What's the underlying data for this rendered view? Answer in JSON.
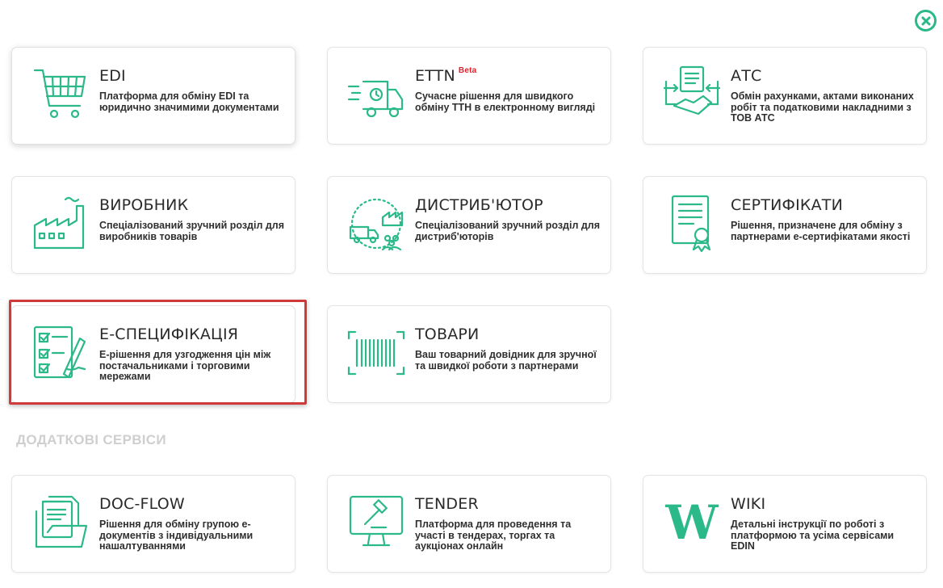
{
  "colors": {
    "accent": "#2bb98a",
    "beta": "#e0202a",
    "highlight": "#d13a3a",
    "section": "#cfcfcf"
  },
  "close_icon": "close-circle-icon",
  "services": [
    {
      "id": "edi",
      "icon": "shopping-cart-icon",
      "title": "EDI",
      "badge": "",
      "desc": "Платформа для обміну EDI та юридично значимими документами"
    },
    {
      "id": "ettn",
      "icon": "delivery-truck-icon",
      "title": "ETTN",
      "badge": "Beta",
      "desc": "Сучасне рішення для швидкого обміну ТТН в електронному вигляді"
    },
    {
      "id": "atc",
      "icon": "document-handshake-icon",
      "title": "АТС",
      "badge": "",
      "desc": "Обмін рахунками, актами виконаних робіт та податковими накладними з ТОВ АТС"
    },
    {
      "id": "vyrobnyk",
      "icon": "factory-icon",
      "title": "ВИРОБНИК",
      "badge": "",
      "desc": "Спеціалізований зручний розділ для виробників товарів"
    },
    {
      "id": "distributor",
      "icon": "distribution-icon",
      "title": "ДИСТРИБ'ЮТОР",
      "badge": "",
      "desc": "Спеціалізований зручний розділ для дистриб'юторів"
    },
    {
      "id": "certificates",
      "icon": "certificate-icon",
      "title": "СЕРТИФІКАТИ",
      "badge": "",
      "desc": "Рішення, призначене для обміну з партнерами е-сертифікатами якості"
    },
    {
      "id": "especification",
      "icon": "checklist-signing-icon",
      "title": "Е-СПЕЦИФІКАЦІЯ",
      "badge": "",
      "desc": "Е-рішення для узгодження цін між постачальниками і торговими мережами"
    },
    {
      "id": "tovary",
      "icon": "barcode-icon",
      "title": "ТОВАРИ",
      "badge": "",
      "desc": "Ваш товарний довідник для зручної та швидкої роботи з партнерами"
    }
  ],
  "additional_section_label": "ДОДАТКОВІ СЕРВІСИ",
  "additional": [
    {
      "id": "docflow",
      "icon": "document-folder-icon",
      "title": "DOC-FLOW",
      "desc": "Рішення для обміну групою е-документів з індивідуальними нашалтуваннями"
    },
    {
      "id": "tender",
      "icon": "auction-monitor-icon",
      "title": "TENDER",
      "desc": "Платформа для проведення та участі в тендерах, торгах та аукціонах онлайн"
    },
    {
      "id": "wiki",
      "icon": "wiki-w-icon",
      "title": "WIKI",
      "desc": "Детальні інструкції по роботі з платформою та усіма сервісами EDIN"
    }
  ]
}
